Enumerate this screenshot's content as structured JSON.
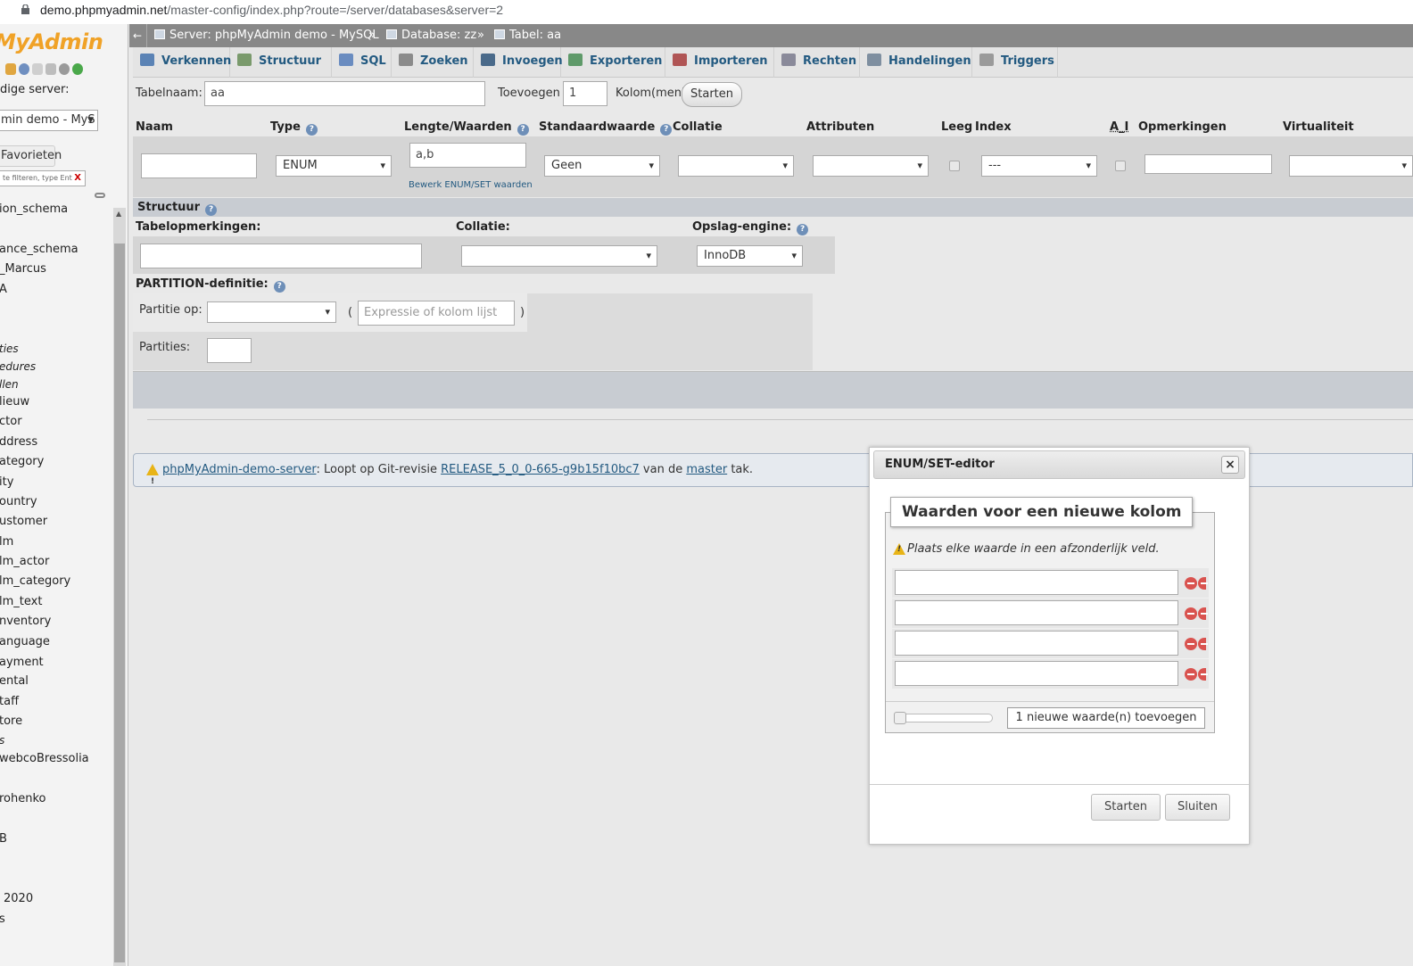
{
  "browser": {
    "url_host": "demo.phpmyadmin.net",
    "url_rest": "/master-config/index.php?route=/server/databases&server=2"
  },
  "nav": {
    "logo": "MyAdmin",
    "recent_label": "dige server:",
    "server_select": "min demo - MyS",
    "favorites_button": "Favorieten",
    "filter_placeholder": "te filteren, type Ent",
    "filter_clear": "X",
    "tree": [
      {
        "label": "ion_schema",
        "italic": false
      },
      {
        "label": "ance_schema",
        "italic": false
      },
      {
        "label": "_Marcus",
        "italic": false
      },
      {
        "label": "A",
        "italic": false
      },
      {
        "label": "ties",
        "italic": true
      },
      {
        "label": "edures",
        "italic": true
      },
      {
        "label": "llen",
        "italic": true
      },
      {
        "label": "lieuw",
        "italic": false
      },
      {
        "label": "ctor",
        "italic": false
      },
      {
        "label": "ddress",
        "italic": false
      },
      {
        "label": "ategory",
        "italic": false
      },
      {
        "label": "ity",
        "italic": false
      },
      {
        "label": "ountry",
        "italic": false
      },
      {
        "label": "ustomer",
        "italic": false
      },
      {
        "label": "lm",
        "italic": false
      },
      {
        "label": "lm_actor",
        "italic": false
      },
      {
        "label": "lm_category",
        "italic": false
      },
      {
        "label": "lm_text",
        "italic": false
      },
      {
        "label": "nventory",
        "italic": false
      },
      {
        "label": "anguage",
        "italic": false
      },
      {
        "label": "ayment",
        "italic": false
      },
      {
        "label": "ental",
        "italic": false
      },
      {
        "label": "taff",
        "italic": false
      },
      {
        "label": "tore",
        "italic": false
      },
      {
        "label": "s",
        "italic": true
      },
      {
        "label": "webcoBressolia",
        "italic": false
      },
      {
        "label": "",
        "italic": false
      },
      {
        "label": "rohenko",
        "italic": false
      },
      {
        "label": "B",
        "italic": false
      },
      {
        "label": "2020",
        "italic": false
      },
      {
        "label": "s",
        "italic": false
      }
    ]
  },
  "breadcrumb": {
    "back": "←",
    "server": "Server: phpMyAdmin demo - MySQL",
    "database": "Database: zz",
    "table": "Tabel: aa",
    "sep": "»"
  },
  "tabs": [
    {
      "label": "Verkennen",
      "icon": "browse-icon",
      "color": "#5b83b5"
    },
    {
      "label": "Structuur",
      "icon": "structure-icon",
      "color": "#7a9a6c"
    },
    {
      "label": "SQL",
      "icon": "sql-icon",
      "color": "#6a8cc0"
    },
    {
      "label": "Zoeken",
      "icon": "search-icon",
      "color": "#8b8b8b"
    },
    {
      "label": "Invoegen",
      "icon": "insert-icon",
      "color": "#4a6a8a"
    },
    {
      "label": "Exporteren",
      "icon": "export-icon",
      "color": "#5f9a6a"
    },
    {
      "label": "Importeren",
      "icon": "import-icon",
      "color": "#b05555"
    },
    {
      "label": "Rechten",
      "icon": "privileges-icon",
      "color": "#8a8a9a"
    },
    {
      "label": "Handelingen",
      "icon": "operations-icon",
      "color": "#7f8fa0"
    },
    {
      "label": "Triggers",
      "icon": "triggers-icon",
      "color": "#9a9a9a"
    }
  ],
  "form": {
    "tablename_label": "Tabelnaam:",
    "tablename_value": "aa",
    "add_label": "Toevoegen",
    "add_count": "1",
    "columns_label": "Kolom(men)",
    "go_button": "Starten",
    "headers": {
      "name": "Naam",
      "type": "Type",
      "length": "Lengte/Waarden",
      "default": "Standaardwaarde",
      "collation": "Collatie",
      "attributes": "Attributen",
      "null": "Leeg",
      "index": "Index",
      "ai": "A_I",
      "comments": "Opmerkingen",
      "virtuality": "Virtualiteit"
    },
    "column_row": {
      "name": "",
      "type": "ENUM",
      "length": "a,b",
      "length_edit_link": "Bewerk ENUM/SET waarden",
      "default": "Geen",
      "collation": "",
      "attributes": "",
      "index": "---",
      "comments": "",
      "virtuality": ""
    },
    "structure_label": "Structuur",
    "table_comments_label": "Tabelopmerkingen:",
    "collation_label": "Collatie:",
    "engine_label": "Opslag-engine:",
    "engine_value": "InnoDB",
    "partition_label": "PARTITION-definitie:",
    "partition_by_label": "Partitie op:",
    "partition_expr_placeholder": "Expressie of kolom lijst",
    "paren_open": "(",
    "paren_close": ")",
    "partitions_label": "Partities:"
  },
  "notice": {
    "link1": "phpMyAdmin-demo-server",
    "text1": ": Loopt op Git-revisie ",
    "link2": "RELEASE_5_0_0-665-g9b15f10bc7",
    "text2": " van de ",
    "link3": "master",
    "text3": " tak."
  },
  "dialog": {
    "title": "ENUM/SET-editor",
    "close": "×",
    "legend": "Waarden voor een nieuwe kolom",
    "hint": "Plaats elke waarde in een afzonderlijk veld.",
    "values": [
      "",
      "",
      "",
      ""
    ],
    "add_values_button": "1 nieuwe waarde(n) toevoegen",
    "go_button": "Starten",
    "close_button": "Sluiten"
  },
  "colors": {
    "accent": "#235a81",
    "logo": "#f0a227",
    "breadcrumb_bg": "#888888"
  }
}
